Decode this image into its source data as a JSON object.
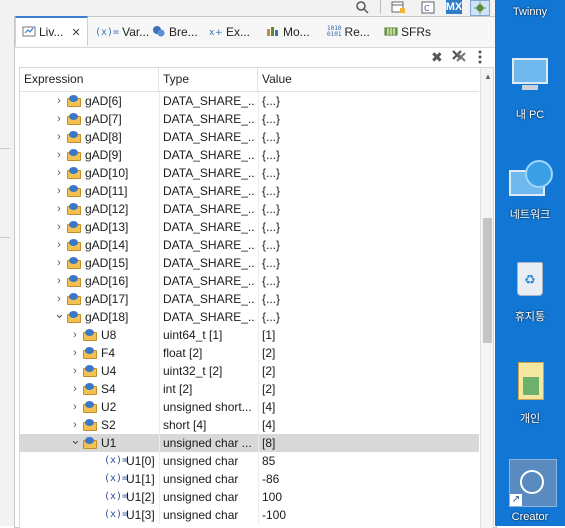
{
  "toolbar": {
    "search_icon": "search-icon",
    "mx_label": "MX"
  },
  "tabs": [
    {
      "label": "Liv...",
      "icon": "live-expressions-icon",
      "active": true,
      "close": "✕"
    },
    {
      "label": "Var...",
      "icon": "(x)=",
      "active": false
    },
    {
      "label": "Bre...",
      "icon": "breakpoints-icon",
      "active": false
    },
    {
      "label": "Ex...",
      "icon": "expressions-icon",
      "active": false
    },
    {
      "label": "Mo...",
      "icon": "memory-icon",
      "active": false
    },
    {
      "label": "Re...",
      "icon": "1010\n0101",
      "active": false
    },
    {
      "label": "SFRs",
      "icon": "sfr-icon",
      "active": false
    }
  ],
  "columns": {
    "expression": "Expression",
    "type": "Type",
    "value": "Value"
  },
  "rows": [
    {
      "expr": "gAD[6]",
      "type": "DATA_SHARE_...",
      "value": "{...}",
      "level": 1,
      "kind": "struct",
      "expanded": false
    },
    {
      "expr": "gAD[7]",
      "type": "DATA_SHARE_...",
      "value": "{...}",
      "level": 1,
      "kind": "struct",
      "expanded": false
    },
    {
      "expr": "gAD[8]",
      "type": "DATA_SHARE_...",
      "value": "{...}",
      "level": 1,
      "kind": "struct",
      "expanded": false
    },
    {
      "expr": "gAD[9]",
      "type": "DATA_SHARE_...",
      "value": "{...}",
      "level": 1,
      "kind": "struct",
      "expanded": false
    },
    {
      "expr": "gAD[10]",
      "type": "DATA_SHARE_...",
      "value": "{...}",
      "level": 1,
      "kind": "struct",
      "expanded": false
    },
    {
      "expr": "gAD[11]",
      "type": "DATA_SHARE_...",
      "value": "{...}",
      "level": 1,
      "kind": "struct",
      "expanded": false
    },
    {
      "expr": "gAD[12]",
      "type": "DATA_SHARE_...",
      "value": "{...}",
      "level": 1,
      "kind": "struct",
      "expanded": false
    },
    {
      "expr": "gAD[13]",
      "type": "DATA_SHARE_...",
      "value": "{...}",
      "level": 1,
      "kind": "struct",
      "expanded": false
    },
    {
      "expr": "gAD[14]",
      "type": "DATA_SHARE_...",
      "value": "{...}",
      "level": 1,
      "kind": "struct",
      "expanded": false
    },
    {
      "expr": "gAD[15]",
      "type": "DATA_SHARE_...",
      "value": "{...}",
      "level": 1,
      "kind": "struct",
      "expanded": false
    },
    {
      "expr": "gAD[16]",
      "type": "DATA_SHARE_...",
      "value": "{...}",
      "level": 1,
      "kind": "struct",
      "expanded": false
    },
    {
      "expr": "gAD[17]",
      "type": "DATA_SHARE_...",
      "value": "{...}",
      "level": 1,
      "kind": "struct",
      "expanded": false
    },
    {
      "expr": "gAD[18]",
      "type": "DATA_SHARE_...",
      "value": "{...}",
      "level": 1,
      "kind": "struct",
      "expanded": true
    },
    {
      "expr": "U8",
      "type": "uint64_t [1]",
      "value": "[1]",
      "level": 2,
      "kind": "struct",
      "expanded": false
    },
    {
      "expr": "F4",
      "type": "float [2]",
      "value": "[2]",
      "level": 2,
      "kind": "struct",
      "expanded": false
    },
    {
      "expr": "U4",
      "type": "uint32_t [2]",
      "value": "[2]",
      "level": 2,
      "kind": "struct",
      "expanded": false
    },
    {
      "expr": "S4",
      "type": "int [2]",
      "value": "[2]",
      "level": 2,
      "kind": "struct",
      "expanded": false
    },
    {
      "expr": "U2",
      "type": "unsigned short...",
      "value": "[4]",
      "level": 2,
      "kind": "struct",
      "expanded": false
    },
    {
      "expr": "S2",
      "type": "short [4]",
      "value": "[4]",
      "level": 2,
      "kind": "struct",
      "expanded": false
    },
    {
      "expr": "U1",
      "type": "unsigned char ...",
      "value": "[8]",
      "level": 2,
      "kind": "struct",
      "expanded": true,
      "selected": true
    },
    {
      "expr": "U1[0]",
      "type": "unsigned char",
      "value": "85",
      "level": 3,
      "kind": "var"
    },
    {
      "expr": "U1[1]",
      "type": "unsigned char",
      "value": "-86",
      "level": 3,
      "kind": "var"
    },
    {
      "expr": "U1[2]",
      "type": "unsigned char",
      "value": "100",
      "level": 3,
      "kind": "var"
    },
    {
      "expr": "U1[3]",
      "type": "unsigned char",
      "value": "-100",
      "level": 3,
      "kind": "var"
    }
  ],
  "desktop": {
    "user": "Twinny",
    "icons": [
      {
        "label": "내 PC",
        "kind": "pc"
      },
      {
        "label": "네트워크",
        "kind": "network"
      },
      {
        "label": "휴지통",
        "kind": "recycle-bin"
      },
      {
        "label": "개인",
        "kind": "folder"
      },
      {
        "label": "Creator",
        "kind": "app"
      }
    ]
  }
}
